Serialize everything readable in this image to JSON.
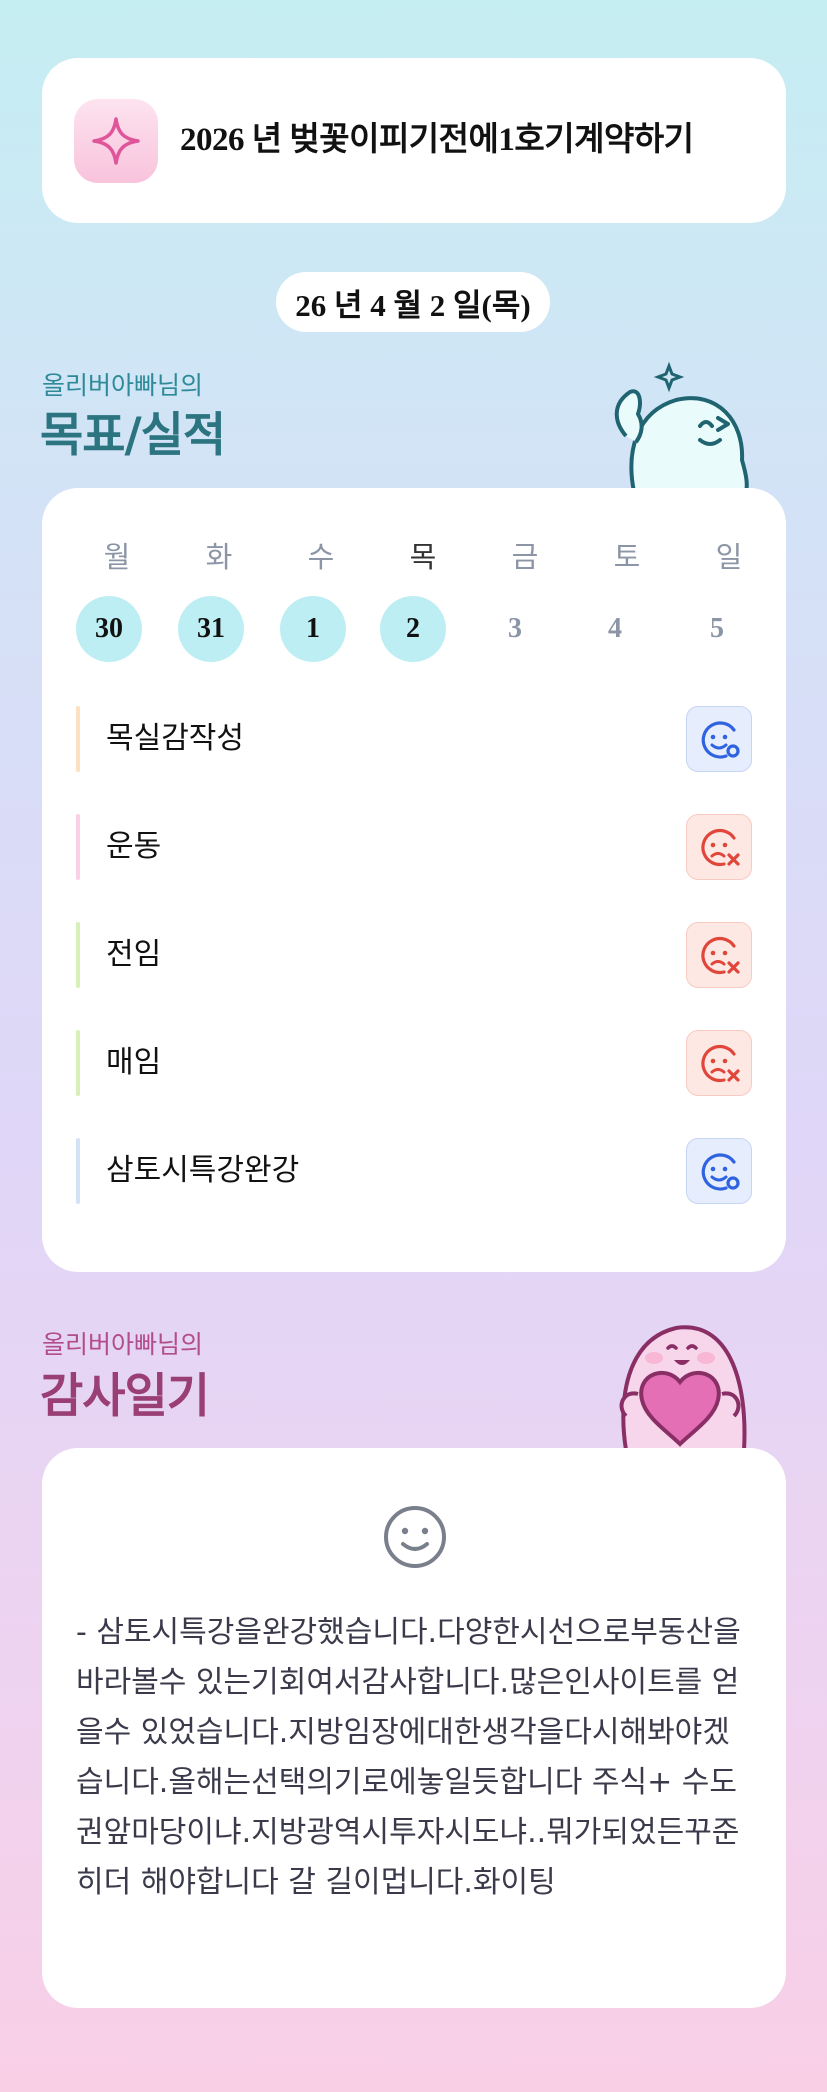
{
  "goal": {
    "text": "2026 년 벚꽃이피기전에1호기계약하기",
    "icon": "sparkle-icon"
  },
  "date": "26 년 4 월 2 일(목)",
  "section_goals": {
    "subtitle": "올리버아빠님의",
    "title": "목표/실적"
  },
  "calendar": {
    "days": [
      {
        "name": "월",
        "num": "30",
        "done": true
      },
      {
        "name": "화",
        "num": "31",
        "done": true
      },
      {
        "name": "수",
        "num": "1",
        "done": true
      },
      {
        "name": "목",
        "num": "2",
        "done": true,
        "today": true
      },
      {
        "name": "금",
        "num": "3",
        "done": false
      },
      {
        "name": "토",
        "num": "4",
        "done": false
      },
      {
        "name": "일",
        "num": "5",
        "done": false
      }
    ]
  },
  "tasks": [
    {
      "label": "목실감작성",
      "status": "success",
      "bar_color": "#fde0c2"
    },
    {
      "label": "운동",
      "status": "fail",
      "bar_color": "#fbd0e6"
    },
    {
      "label": "전임",
      "status": "fail",
      "bar_color": "#d7f0b8"
    },
    {
      "label": "매임",
      "status": "fail",
      "bar_color": "#d7f0b8"
    },
    {
      "label": "삼토시특강완강",
      "status": "success",
      "bar_color": "#d3e3f6"
    }
  ],
  "section_diary": {
    "subtitle": "올리버아빠님의",
    "title": "감사일기"
  },
  "diary": {
    "mood_icon": "smile-face-icon",
    "text": "- 삼토시특강을완강했습니다.다양한시선으로부동산을 바라볼수 있는기회여서감사합니다.많은인사이트를 얻을수 있었습니다.지방임장에대한생각을다시해봐야겠습니다.올해는선택의기로에놓일듯합니다 주식+ 수도권앞마당이냐.지방광역시투자시도냐..뭐가되었든꾸준히더 해야합니다 갈 길이멉니다.화이팅"
  },
  "colors": {
    "accent_teal": "#2b7480",
    "accent_pink": "#9a3f76",
    "success": "#2f63e0",
    "fail": "#e0463a"
  }
}
